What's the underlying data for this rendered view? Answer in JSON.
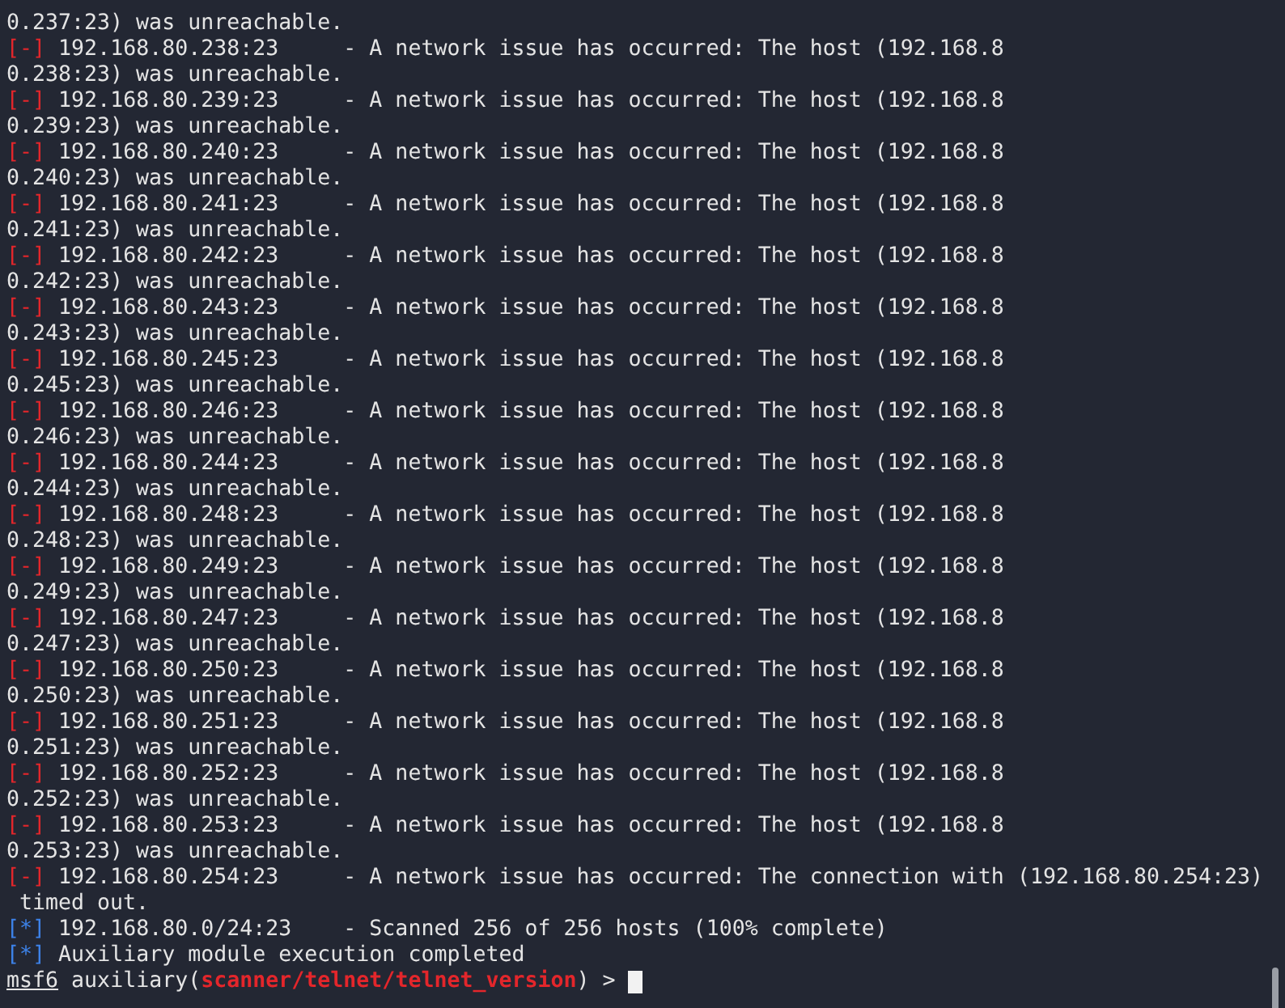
{
  "terminal": {
    "lines": [
      {
        "kind": "plain",
        "text": "0.237:23) was unreachable."
      },
      {
        "kind": "error",
        "marker": "[-]",
        "text": "192.168.80.238:23     - A network issue has occurred: The host (192.168.8"
      },
      {
        "kind": "plain",
        "text": "0.238:23) was unreachable."
      },
      {
        "kind": "error",
        "marker": "[-]",
        "text": "192.168.80.239:23     - A network issue has occurred: The host (192.168.8"
      },
      {
        "kind": "plain",
        "text": "0.239:23) was unreachable."
      },
      {
        "kind": "error",
        "marker": "[-]",
        "text": "192.168.80.240:23     - A network issue has occurred: The host (192.168.8"
      },
      {
        "kind": "plain",
        "text": "0.240:23) was unreachable."
      },
      {
        "kind": "error",
        "marker": "[-]",
        "text": "192.168.80.241:23     - A network issue has occurred: The host (192.168.8"
      },
      {
        "kind": "plain",
        "text": "0.241:23) was unreachable."
      },
      {
        "kind": "error",
        "marker": "[-]",
        "text": "192.168.80.242:23     - A network issue has occurred: The host (192.168.8"
      },
      {
        "kind": "plain",
        "text": "0.242:23) was unreachable."
      },
      {
        "kind": "error",
        "marker": "[-]",
        "text": "192.168.80.243:23     - A network issue has occurred: The host (192.168.8"
      },
      {
        "kind": "plain",
        "text": "0.243:23) was unreachable."
      },
      {
        "kind": "error",
        "marker": "[-]",
        "text": "192.168.80.245:23     - A network issue has occurred: The host (192.168.8"
      },
      {
        "kind": "plain",
        "text": "0.245:23) was unreachable."
      },
      {
        "kind": "error",
        "marker": "[-]",
        "text": "192.168.80.246:23     - A network issue has occurred: The host (192.168.8"
      },
      {
        "kind": "plain",
        "text": "0.246:23) was unreachable."
      },
      {
        "kind": "error",
        "marker": "[-]",
        "text": "192.168.80.244:23     - A network issue has occurred: The host (192.168.8"
      },
      {
        "kind": "plain",
        "text": "0.244:23) was unreachable."
      },
      {
        "kind": "error",
        "marker": "[-]",
        "text": "192.168.80.248:23     - A network issue has occurred: The host (192.168.8"
      },
      {
        "kind": "plain",
        "text": "0.248:23) was unreachable."
      },
      {
        "kind": "error",
        "marker": "[-]",
        "text": "192.168.80.249:23     - A network issue has occurred: The host (192.168.8"
      },
      {
        "kind": "plain",
        "text": "0.249:23) was unreachable."
      },
      {
        "kind": "error",
        "marker": "[-]",
        "text": "192.168.80.247:23     - A network issue has occurred: The host (192.168.8"
      },
      {
        "kind": "plain",
        "text": "0.247:23) was unreachable."
      },
      {
        "kind": "error",
        "marker": "[-]",
        "text": "192.168.80.250:23     - A network issue has occurred: The host (192.168.8"
      },
      {
        "kind": "plain",
        "text": "0.250:23) was unreachable."
      },
      {
        "kind": "error",
        "marker": "[-]",
        "text": "192.168.80.251:23     - A network issue has occurred: The host (192.168.8"
      },
      {
        "kind": "plain",
        "text": "0.251:23) was unreachable."
      },
      {
        "kind": "error",
        "marker": "[-]",
        "text": "192.168.80.252:23     - A network issue has occurred: The host (192.168.8"
      },
      {
        "kind": "plain",
        "text": "0.252:23) was unreachable."
      },
      {
        "kind": "error",
        "marker": "[-]",
        "text": "192.168.80.253:23     - A network issue has occurred: The host (192.168.8"
      },
      {
        "kind": "plain",
        "text": "0.253:23) was unreachable."
      },
      {
        "kind": "error",
        "marker": "[-]",
        "text": "192.168.80.254:23     - A network issue has occurred: The connection with (192.168.80.254:23)"
      },
      {
        "kind": "plain",
        "text": " timed out."
      },
      {
        "kind": "info",
        "marker": "[*]",
        "text": "192.168.80.0/24:23    - Scanned 256 of 256 hosts (100% complete)"
      },
      {
        "kind": "info",
        "marker": "[*]",
        "text": "Auxiliary module execution completed"
      }
    ],
    "prompt": {
      "name": "msf6",
      "before": "auxiliary(",
      "module": "scanner/telnet/telnet_version",
      "after": ") >"
    }
  }
}
